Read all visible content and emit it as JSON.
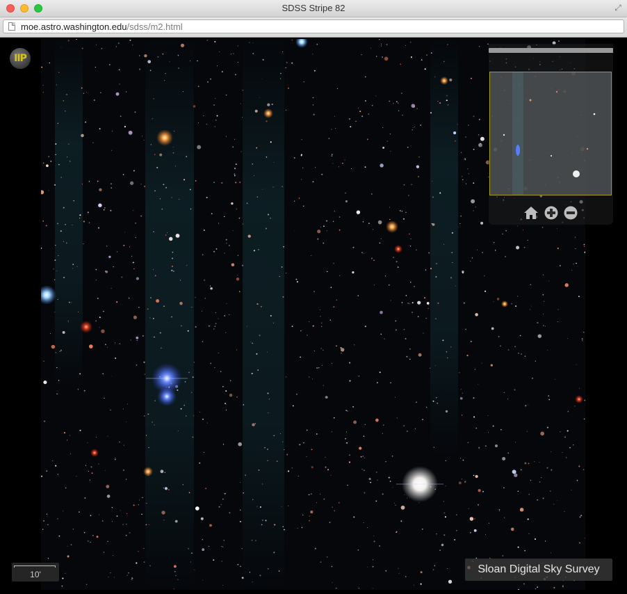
{
  "window": {
    "title": "SDSS Stripe 82"
  },
  "address": {
    "host": "moe.astro.washington.edu",
    "path": "/sdss/m2.html"
  },
  "viewer": {
    "logo_text": "IIP",
    "scale_label": "10'",
    "credit": "Sloan Digital Sky Survey"
  },
  "navigation": {
    "controls": [
      "home-icon",
      "zoom-in-icon",
      "zoom-out-icon"
    ]
  },
  "colors": {
    "sky_background": "#05070b",
    "nav_border": "#a39b23",
    "logo_text": "#d8c418"
  }
}
